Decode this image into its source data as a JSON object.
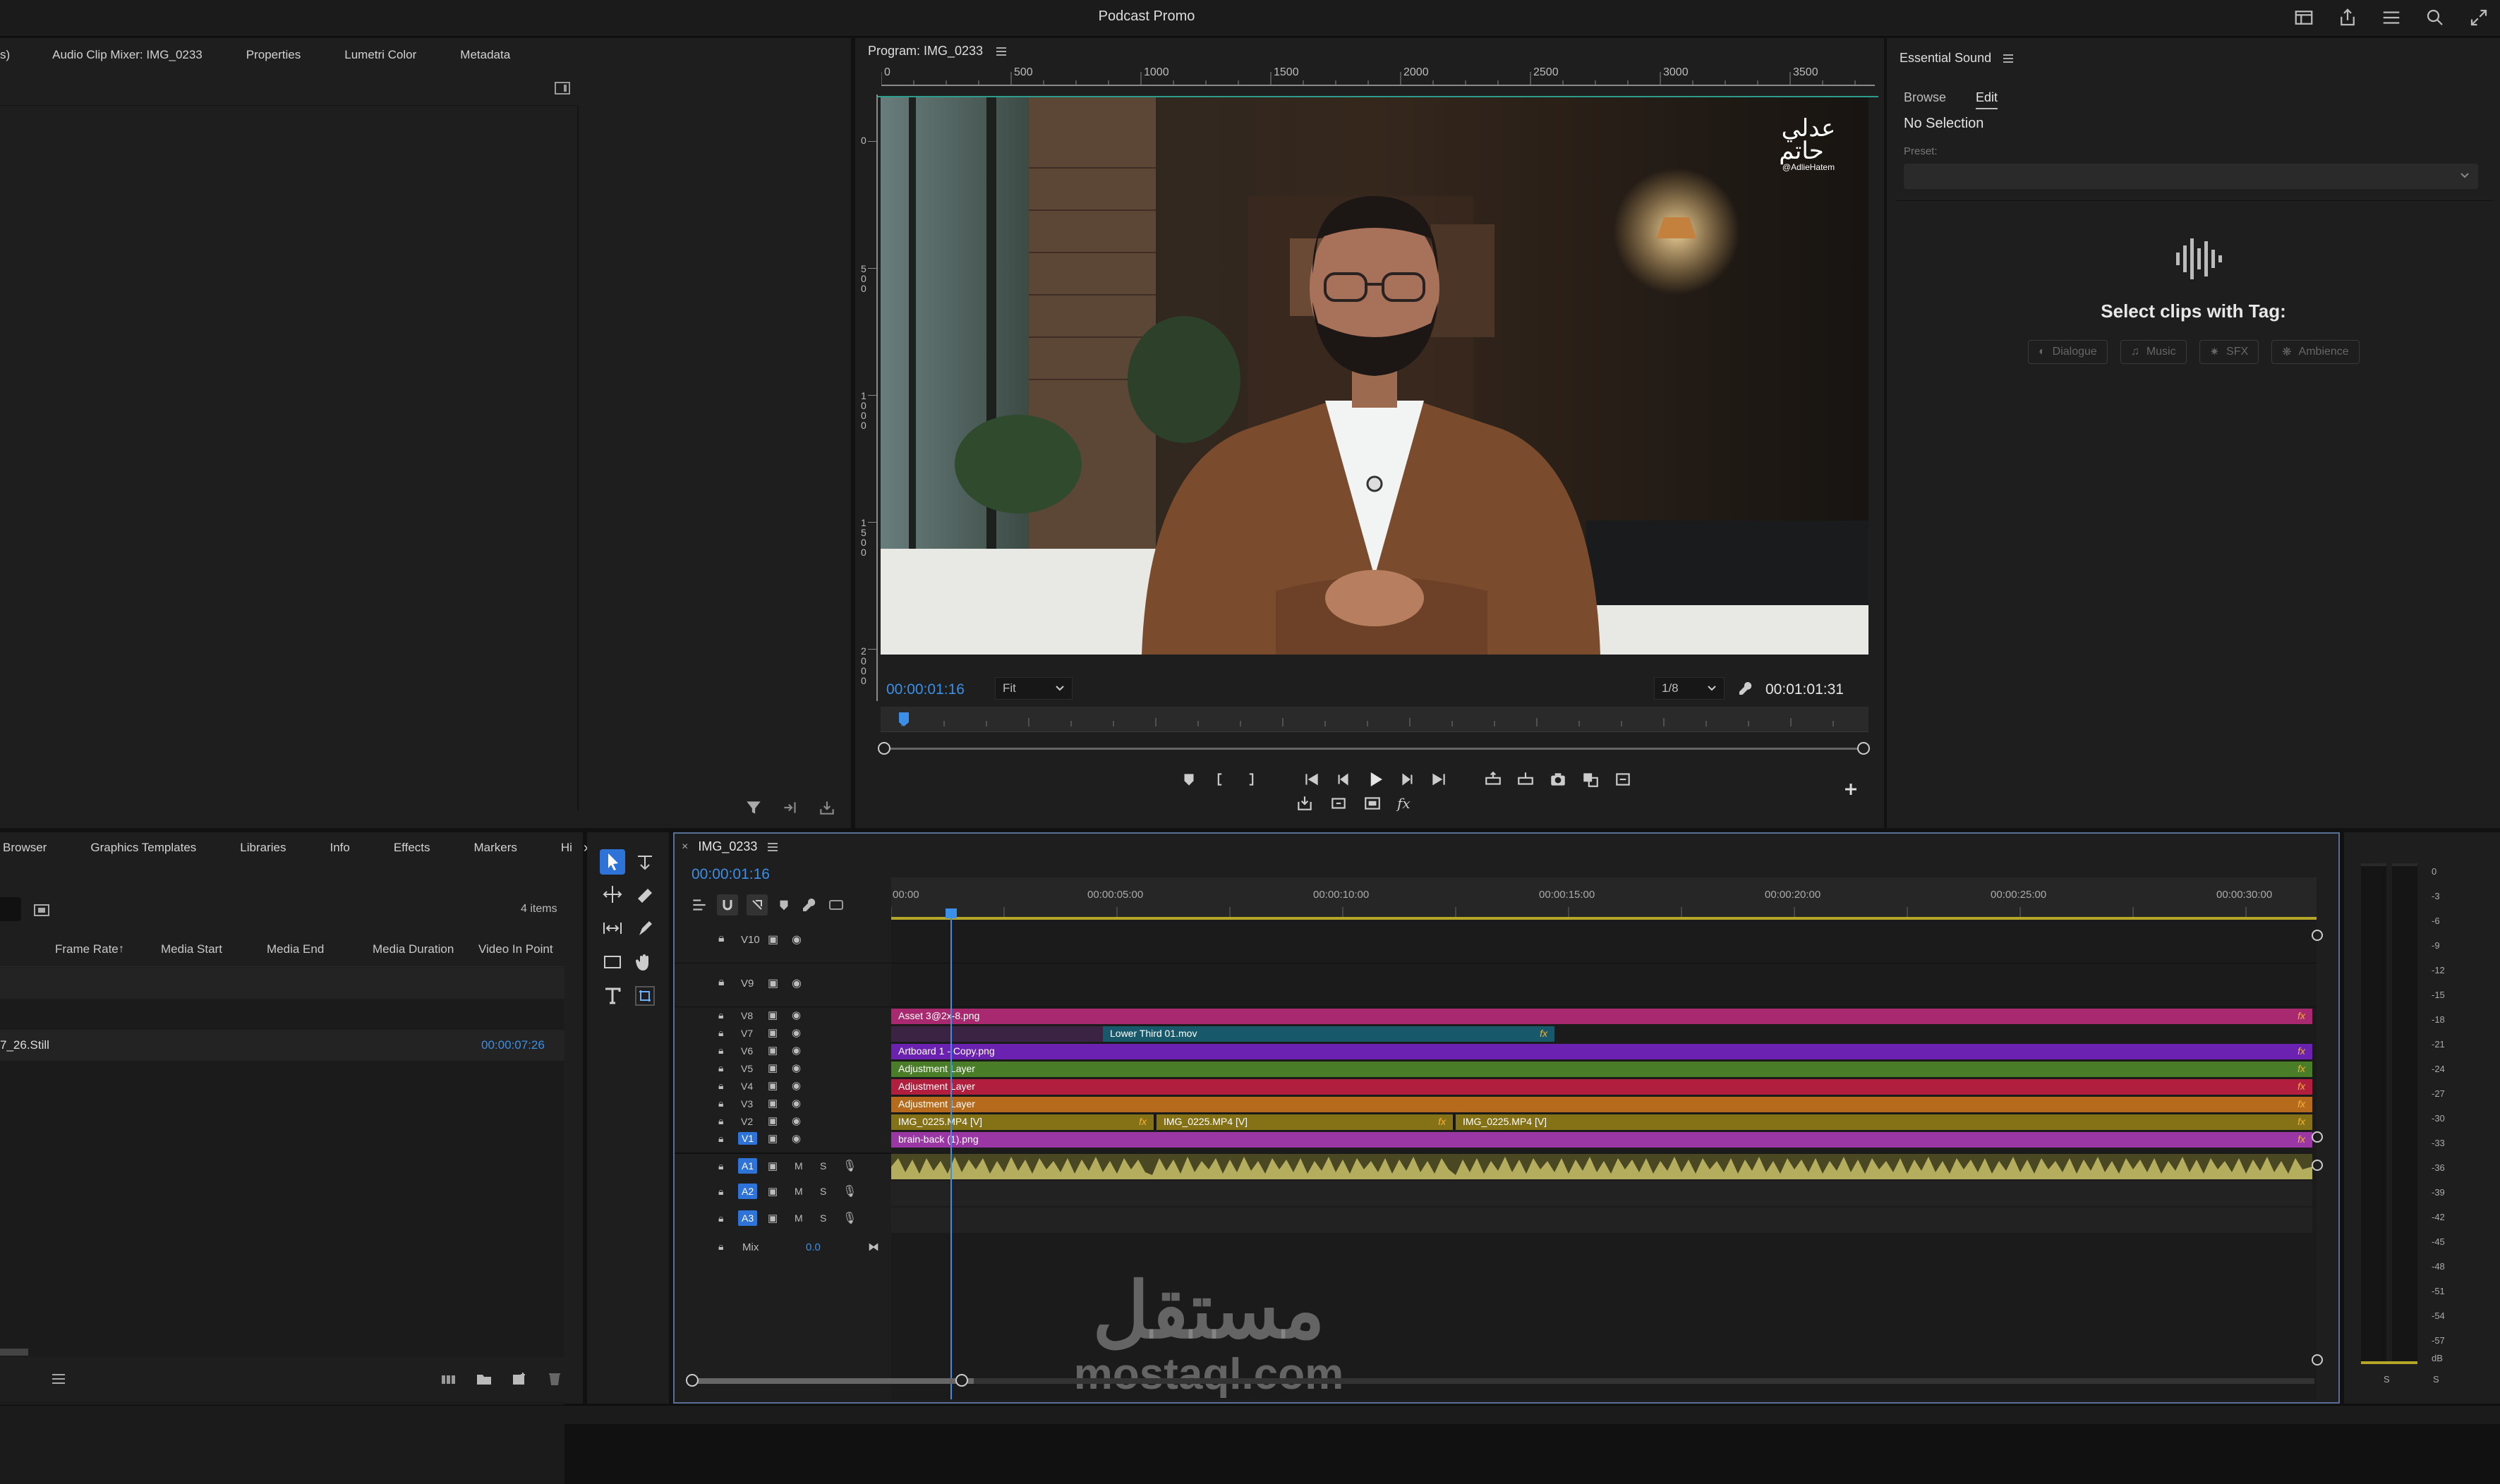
{
  "app": {
    "title": "Podcast Promo"
  },
  "top_tabs": [
    {
      "label": "s)"
    },
    {
      "label": "Audio Clip Mixer: IMG_0233"
    },
    {
      "label": "Properties"
    },
    {
      "label": "Lumetri Color"
    },
    {
      "label": "Metadata"
    }
  ],
  "program": {
    "tab": "Program: IMG_0233",
    "ruler": [
      "0",
      "500",
      "1000",
      "1500",
      "2000",
      "2500",
      "3000",
      "3500"
    ],
    "vruler": [
      "0",
      "500",
      "1000",
      "1500",
      "2000"
    ],
    "timecode": "00:00:01:16",
    "fit": "Fit",
    "resolution": "1/8",
    "duration": "00:01:01:31",
    "watermark": {
      "lines": [
        "عدلي",
        "حاتم"
      ],
      "handle": "@AdlieHatem"
    }
  },
  "essential_sound": {
    "title": "Essential Sound",
    "tabs": [
      "Browse",
      "Edit"
    ],
    "status": "No Selection",
    "preset_label": "Preset:",
    "heading": "Select clips with Tag:",
    "tags": [
      "Dialogue",
      "Music",
      "SFX",
      "Ambience"
    ]
  },
  "project": {
    "tabs": [
      "Browser",
      "Graphics Templates",
      "Libraries",
      "Info",
      "Effects",
      "Markers",
      "Hi"
    ],
    "count": "4 items",
    "columns": [
      "Frame Rate",
      "Media Start",
      "Media End",
      "Media Duration",
      "Video In Point"
    ],
    "row": {
      "name": "7_26.Still",
      "in_point": "00:00:07:26"
    }
  },
  "sequence": {
    "tab": "IMG_0233",
    "timecode": "00:00:01:16",
    "ruler": [
      "00:00",
      "00:00:05:00",
      "00:00:10:00",
      "00:00:15:00",
      "00:00:20:00",
      "00:00:25:00",
      "00:00:30:00"
    ],
    "mix_label": "Mix",
    "mix_value": "0.0"
  },
  "video_tracks": [
    {
      "id": "V10"
    },
    {
      "id": "V9"
    },
    {
      "id": "V8"
    },
    {
      "id": "V7"
    },
    {
      "id": "V6"
    },
    {
      "id": "V5"
    },
    {
      "id": "V4"
    },
    {
      "id": "V3"
    },
    {
      "id": "V2"
    },
    {
      "id": "V1"
    }
  ],
  "audio_tracks": [
    {
      "id": "A1",
      "m": "M",
      "s": "S"
    },
    {
      "id": "A2",
      "m": "M",
      "s": "S"
    },
    {
      "id": "A3",
      "m": "M",
      "s": "S"
    }
  ],
  "clips": {
    "v8": "Asset 3@2x-8.png",
    "v7": "Lower Third 01.mov",
    "v6": "Artboard 1 - Copy.png",
    "v5": "Adjustment Layer",
    "v4": "Adjustment Layer",
    "v3": "Adjustment Layer",
    "v2a": "IMG_0225.MP4 [V]",
    "v2b": "IMG_0225.MP4 [V]",
    "v2c": "IMG_0225.MP4 [V]",
    "v1": "brain-back (1).png",
    "fx": "fx"
  },
  "meter": {
    "scale": [
      "0",
      "-3",
      "-6",
      "-9",
      "-12",
      "-15",
      "-18",
      "-21",
      "-24",
      "-27",
      "-30",
      "-33",
      "-36",
      "-39",
      "-42",
      "-45",
      "-48",
      "-51",
      "-54",
      "-57",
      "dB"
    ],
    "footer": [
      "S",
      "S"
    ]
  },
  "site_watermark": {
    "arabic": "مستقل",
    "latin": "mostaql.com"
  },
  "colors": {
    "accent": "#2d8ceb",
    "v8": "#a8296f",
    "v7": "#17596b",
    "v6": "#6b22b0",
    "adj": "#b8862e",
    "v2": "#857217",
    "v1": "#9b37a5",
    "audio": "#8f8a36"
  }
}
